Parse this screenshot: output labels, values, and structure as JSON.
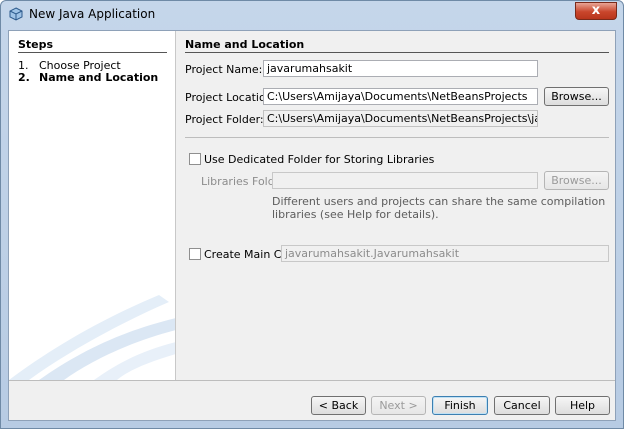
{
  "window": {
    "title": "New Java Application",
    "close_glyph": "x"
  },
  "steps": {
    "title": "Steps",
    "items": [
      {
        "num": "1.",
        "label": "Choose Project"
      },
      {
        "num": "2.",
        "label": "Name and Location"
      }
    ]
  },
  "form": {
    "section_title": "Name and Location",
    "project_name_label": "Project Name:",
    "project_name_value": "javarumahsakit",
    "project_location_label": "Project Location:",
    "project_location_value": "C:\\Users\\Amijaya\\Documents\\NetBeansProjects",
    "browse_label": "Browse...",
    "project_folder_label": "Project Folder:",
    "project_folder_value": "C:\\Users\\Amijaya\\Documents\\NetBeansProjects\\javarumahsakit",
    "dedicated_folder_label": "Use Dedicated Folder for Storing Libraries",
    "libraries_folder_label": "Libraries Folder:",
    "libraries_folder_value": "",
    "libraries_browse_label": "Browse...",
    "libraries_note_line1": "Different users and projects can share the same compilation",
    "libraries_note_line2": "libraries (see Help for details).",
    "main_class_label": "Create Main Class",
    "main_class_value": "javarumahsakit.Javarumahsakit"
  },
  "footer": {
    "back_label": "< Back",
    "next_label": "Next >",
    "finish_label": "Finish",
    "cancel_label": "Cancel",
    "help_label": "Help"
  }
}
